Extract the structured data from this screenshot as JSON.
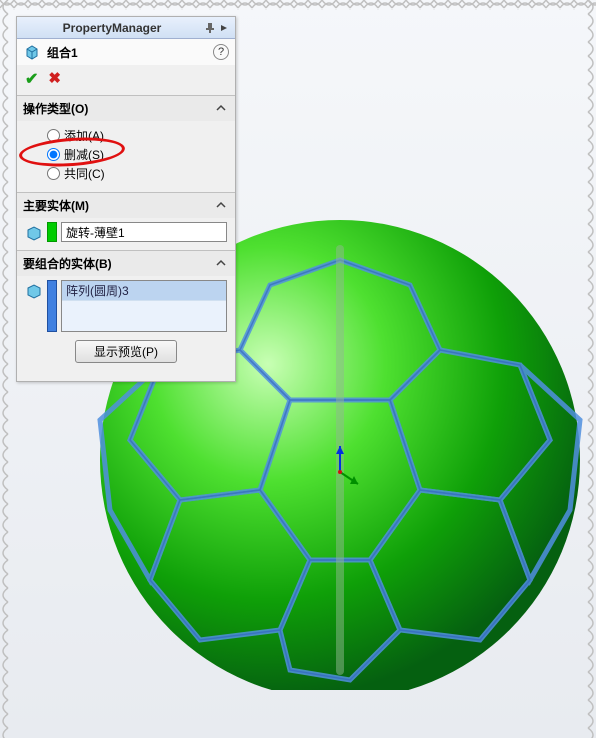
{
  "titlebar": {
    "title": "PropertyManager"
  },
  "feature": {
    "name": "组合1"
  },
  "sections": {
    "opType": {
      "header": "操作类型(O)",
      "options": {
        "add": "添加(A)",
        "subtract": "删减(S)",
        "common": "共同(C)"
      },
      "selected": "subtract"
    },
    "mainEntity": {
      "header": "主要实体(M)",
      "value": "旋转-薄壁1"
    },
    "combineEntity": {
      "header": "要组合的实体(B)",
      "items": [
        "阵列(圆周)3"
      ]
    }
  },
  "buttons": {
    "preview": "显示预览(P)"
  }
}
